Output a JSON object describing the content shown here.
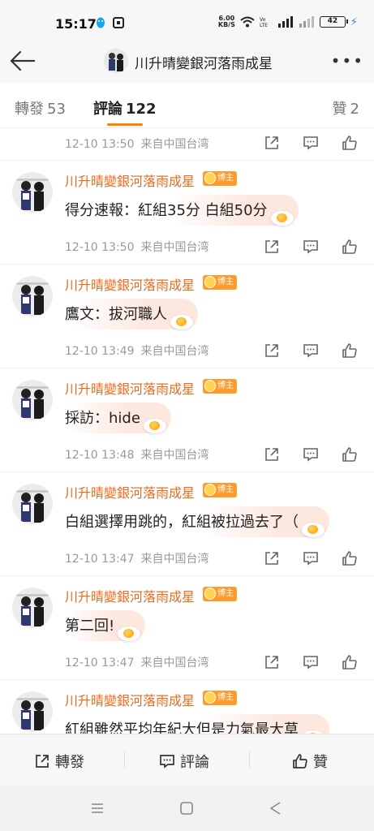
{
  "status": {
    "time": "15:17",
    "net_speed_value": "6.00",
    "net_speed_unit": "KB/S",
    "battery": "42"
  },
  "nav": {
    "title": "川升晴變銀河落雨成星"
  },
  "tabs": {
    "repost_label": "轉發",
    "repost_count": "53",
    "comment_label": "評論",
    "comment_count": "122",
    "like_label": "贊",
    "like_count": "2"
  },
  "feed": {
    "top_meta": {
      "time": "12-10 13:50",
      "location": "来自中国台湾"
    },
    "comments": [
      {
        "name": "川升晴變銀河落雨成星",
        "badge": "博主",
        "text": "得分速報：紅組35分 白組50分",
        "time": "12-10 13:50",
        "location": "来自中国台湾"
      },
      {
        "name": "川升晴變銀河落雨成星",
        "badge": "博主",
        "text": "鷹文：拔河職人",
        "time": "12-10 13:49",
        "location": "来自中国台湾"
      },
      {
        "name": "川升晴變銀河落雨成星",
        "badge": "博主",
        "text": "採訪：hide",
        "time": "12-10 13:48",
        "location": "来自中国台湾"
      },
      {
        "name": "川升晴變銀河落雨成星",
        "badge": "博主",
        "text": "白組選擇用跳的，紅組被拉過去了（",
        "time": "12-10 13:47",
        "location": "来自中国台湾"
      },
      {
        "name": "川升晴變銀河落雨成星",
        "badge": "博主",
        "text": "第二回!",
        "time": "12-10 13:47",
        "location": "来自中国台湾"
      },
      {
        "name": "川升晴變銀河落雨成星",
        "badge": "博主",
        "text": "紅組雖然平均年紀大但是力氣最大草",
        "time": "",
        "location": ""
      }
    ]
  },
  "bottom_bar": {
    "repost": "轉發",
    "comment": "評論",
    "like": "贊"
  },
  "colors": {
    "accent": "#ff8200",
    "name": "#e86b1f",
    "meta": "#999999"
  }
}
